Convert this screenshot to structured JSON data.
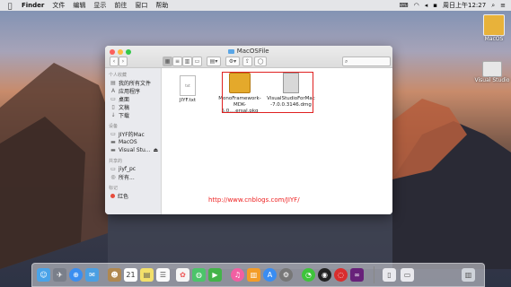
{
  "menubar": {
    "app": "Finder",
    "items": [
      "文件",
      "编辑",
      "显示",
      "前往",
      "窗口",
      "帮助"
    ],
    "clock": "周日上午12:27"
  },
  "desktop": {
    "icons": [
      {
        "label": "MacOS"
      },
      {
        "label": "Visual Studio"
      }
    ]
  },
  "window": {
    "title": "MacOSFile",
    "sidebar": {
      "sections": [
        {
          "header": "个人收藏",
          "items": [
            "我的所有文件",
            "应用程序",
            "桌面",
            "文稿",
            "下载"
          ]
        },
        {
          "header": "设备",
          "items": [
            "JIYF的Mac",
            "MacOS",
            "Visual Stu..."
          ]
        },
        {
          "header": "共享的",
          "items": [
            "jiyf_pc",
            "所有..."
          ]
        },
        {
          "header": "标记",
          "items": [
            "红色"
          ]
        }
      ]
    },
    "files": [
      {
        "name": "JIYF.txt",
        "badge": "txt"
      },
      {
        "name1": "MonoFramework-",
        "name2": "MDK-5.0....ersal.pkg"
      },
      {
        "name1": "VisualStudioForMac",
        "name2": "-7.0.0.3146.dmg"
      }
    ]
  },
  "watermark": "http://www.cnblogs.com/JIYF/",
  "dock": {
    "icons": [
      "finder-icon",
      "launchpad-icon",
      "safari-icon",
      "mail-icon",
      "contacts-icon",
      "calendar-icon",
      "notes-icon",
      "reminders-icon",
      "photos-icon",
      "messages-icon",
      "facetime-icon",
      "itunes-icon",
      "ibooks-icon",
      "appstore-icon",
      "preferences-icon",
      "wechat-icon",
      "qq-icon",
      "netease-icon",
      "visualstudio-icon",
      "trash-icon"
    ],
    "calendar_day": "21"
  }
}
